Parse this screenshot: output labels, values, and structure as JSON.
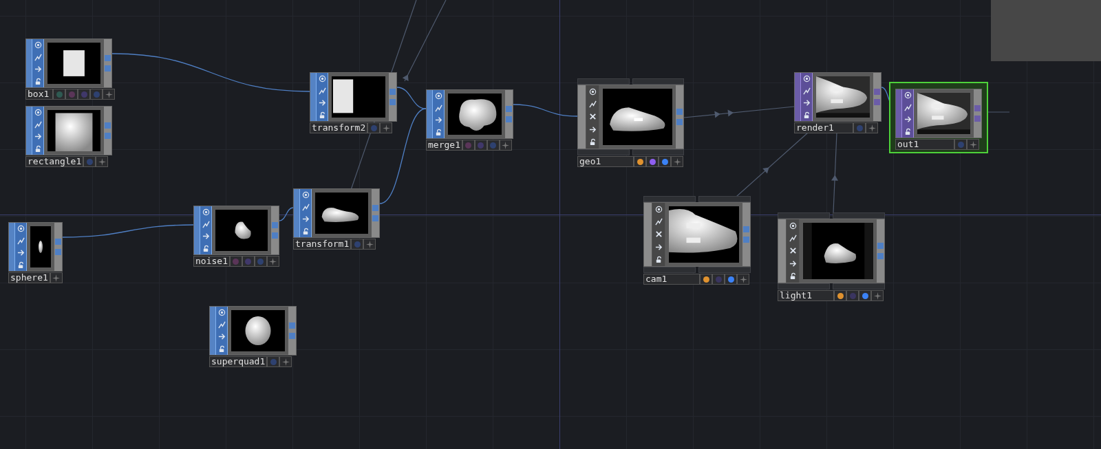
{
  "nodes": [
    {
      "kind": "sop",
      "name": "box1",
      "preview": {
        "kind": "box"
      },
      "selected": false,
      "flags": [
        {
          "color": "#2e5a52"
        },
        {
          "color": "#5a3558"
        },
        {
          "color": "#40386a"
        },
        {
          "color": "#2e4170"
        }
      ]
    },
    {
      "kind": "sop",
      "name": "rectangle1",
      "preview": {
        "kind": "rect"
      },
      "selected": false,
      "flags": [
        {
          "color": "#2e4170"
        }
      ]
    },
    {
      "kind": "sop",
      "name": "transform2",
      "preview": {
        "kind": "offset"
      },
      "selected": false,
      "flags": [
        {
          "color": "#2e4170"
        }
      ]
    },
    {
      "kind": "sop",
      "name": "merge1",
      "preview": {
        "kind": "merge"
      },
      "selected": false,
      "flags": [
        {
          "color": "#5a3558"
        },
        {
          "color": "#40386a"
        },
        {
          "color": "#2e4170"
        }
      ]
    },
    {
      "kind": "sop",
      "name": "sphere1",
      "preview": {
        "kind": "sphere"
      },
      "selected": false
    },
    {
      "kind": "sop",
      "name": "noise1",
      "preview": {
        "kind": "lump"
      },
      "selected": false,
      "flags": [
        {
          "color": "#5a3558"
        },
        {
          "color": "#40386a"
        },
        {
          "color": "#2e4170"
        }
      ]
    },
    {
      "kind": "sop",
      "name": "transform1",
      "preview": {
        "kind": "blob"
      },
      "selected": false,
      "flags": [
        {
          "color": "#2e4170"
        }
      ]
    },
    {
      "kind": "sop",
      "name": "superquad1",
      "preview": {
        "kind": "ball"
      },
      "selected": false,
      "flags": [
        {
          "color": "#2e4170"
        }
      ]
    },
    {
      "kind": "comp",
      "name": "geo1",
      "preview": {
        "kind": "geo"
      },
      "selected": false,
      "flags": [
        {
          "color": "#e0922f"
        },
        {
          "color": "#8f5ff0"
        },
        {
          "color": "#3b82f6"
        }
      ]
    },
    {
      "kind": "top",
      "name": "render1",
      "preview": {
        "kind": "render"
      },
      "selected": false,
      "flags": [
        {
          "color": "#2e4170"
        }
      ]
    },
    {
      "kind": "top",
      "name": "out1",
      "preview": {
        "kind": "render"
      },
      "selected": true,
      "flags": [
        {
          "color": "#2e4170"
        }
      ]
    },
    {
      "kind": "comp",
      "name": "cam1",
      "preview": {
        "kind": "cam"
      },
      "selected": false,
      "flags": [
        {
          "color": "#e0922f"
        },
        {
          "color": "#3a3560"
        },
        {
          "color": "#3b82f6"
        }
      ]
    },
    {
      "kind": "comp",
      "name": "light1",
      "preview": {
        "kind": "light"
      },
      "selected": false,
      "flags": [
        {
          "color": "#e0922f"
        },
        {
          "color": "#3a3560"
        },
        {
          "color": "#3b82f6"
        }
      ]
    }
  ]
}
